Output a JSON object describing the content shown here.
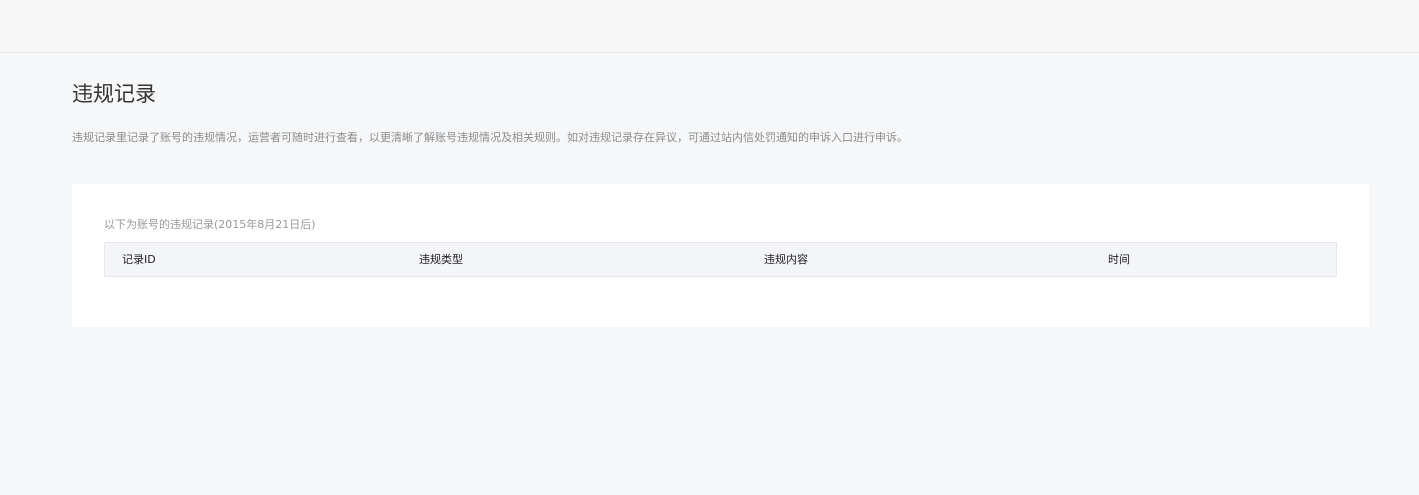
{
  "page": {
    "title": "违规记录",
    "description": "违规记录里记录了账号的违规情况，运营者可随时进行查看，以更清晰了解账号违规情况及相关规则。如对违规记录存在异议，可通过站内信处罚通知的申诉入口进行申诉。"
  },
  "records": {
    "caption": "以下为账号的违规记录(2015年8月21日后)",
    "columns": [
      "记录ID",
      "违规类型",
      "违规内容",
      "时间"
    ],
    "rows": []
  }
}
